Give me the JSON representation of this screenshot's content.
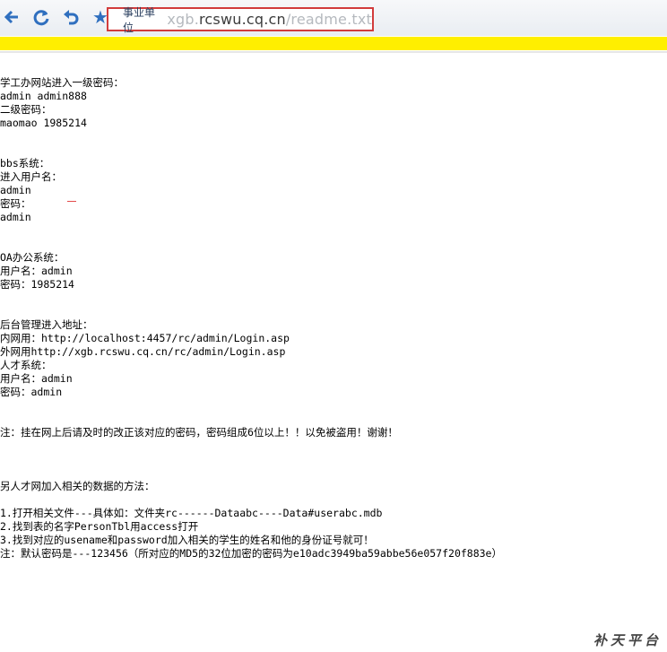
{
  "browser": {
    "zone_label": "事业单位",
    "url_prefix": "xgb.",
    "url_host": "rcswu.cq.cn",
    "url_path": "/readme.txt"
  },
  "document": {
    "lines": [
      "学工办网站进入一级密码：",
      "admin admin888",
      "二级密码：",
      "maomao 1985214",
      "",
      "",
      "bbs系统：",
      "进入用户名：",
      "admin",
      "密码：",
      "admin",
      "",
      "",
      "OA办公系统：",
      "用户名：admin",
      "密码：1985214",
      "",
      "",
      "后台管理进入地址：",
      "内网用：http://localhost:4457/rc/admin/Login.asp",
      "外网用http://xgb.rcswu.cq.cn/rc/admin/Login.asp",
      "人才系统：",
      "用户名：admin",
      "密码：admin",
      "",
      "",
      "注：挂在网上后请及时的改正该对应的密码，密码组成6位以上！！以免被盗用！谢谢！",
      "",
      "",
      "",
      "另人才网加入相关的数据的方法：",
      "",
      "1.打开相关文件---具体如：文件夹rc------Dataabc----Data#userabc.mdb",
      "2.找到表的名字PersonTbl用access打开",
      "3.找到对应的usename和password加入相关的学生的姓名和他的身份证号就可！",
      "注：默认密码是---123456（所对应的MD5的32位加密的密码为e10adc3949ba59abbe56e057f20f883e）"
    ]
  },
  "watermark": "补天平台",
  "colors": {
    "highlight_bar": "#ffef00",
    "address_border": "#d23c3c",
    "icon_blue": "#2f6fbf"
  }
}
